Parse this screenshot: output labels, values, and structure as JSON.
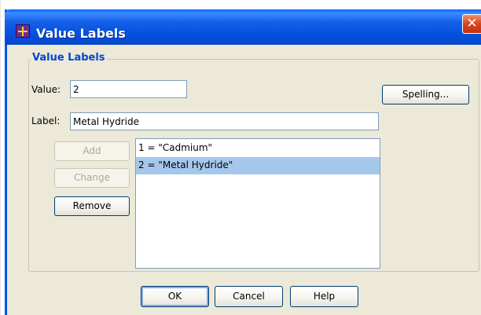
{
  "window": {
    "title": "Value Labels",
    "close_glyph": "✕"
  },
  "group": {
    "legend": "Value Labels"
  },
  "value_field": {
    "label": "Value:",
    "value": "2"
  },
  "label_field": {
    "label": "Label:",
    "value": "Metal Hydride"
  },
  "buttons": {
    "spelling": "Spelling...",
    "add": "Add",
    "change": "Change",
    "remove": "Remove",
    "ok": "OK",
    "cancel": "Cancel",
    "help": "Help"
  },
  "list": {
    "items": [
      {
        "text": "1 = \"Cadmium\"",
        "selected": false
      },
      {
        "text": "2 = \"Metal Hydride\"",
        "selected": true
      }
    ]
  },
  "colors": {
    "titlebar": "#0550df",
    "dialog_bg": "#ece9d8",
    "legend_text": "#0046d5",
    "selection": "#a6c7ec"
  },
  "icons": {
    "title_icon": "value-labels-app-icon",
    "close": "close-icon"
  }
}
